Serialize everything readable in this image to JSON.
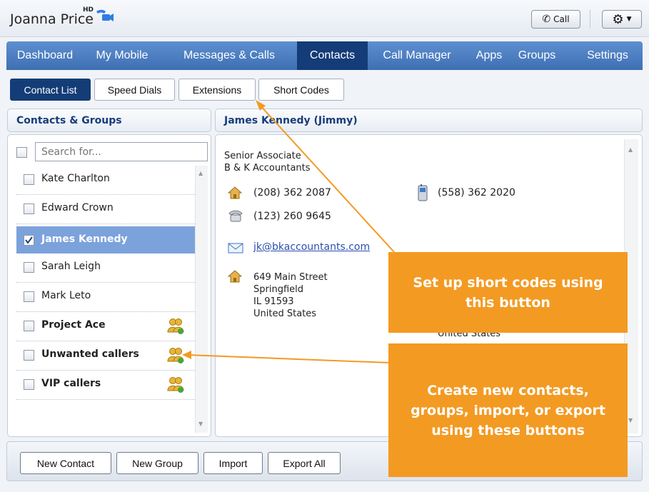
{
  "header": {
    "user_name": "Joanna Price",
    "hd_label": "HD",
    "call_label": "Call"
  },
  "nav": {
    "items": [
      {
        "label": "Dashboard"
      },
      {
        "label": "My Mobile"
      },
      {
        "label": "Messages & Calls"
      },
      {
        "label": "Contacts",
        "active": true
      },
      {
        "label": "Call Manager"
      },
      {
        "label": "Apps"
      },
      {
        "label": "Groups"
      },
      {
        "label": "Settings"
      }
    ]
  },
  "subtabs": [
    {
      "label": "Contact List",
      "active": true
    },
    {
      "label": "Speed Dials"
    },
    {
      "label": "Extensions"
    },
    {
      "label": "Short Codes"
    }
  ],
  "contacts_panel": {
    "title": "Contacts & Groups",
    "search_placeholder": "Search for...",
    "items": [
      {
        "label": "Kate Charlton",
        "type": "contact",
        "checked": false
      },
      {
        "label": "Edward Crown",
        "type": "contact",
        "checked": false
      },
      {
        "label": "James Kennedy",
        "type": "contact",
        "checked": true,
        "selected": true
      },
      {
        "label": "Sarah Leigh",
        "type": "contact",
        "checked": false
      },
      {
        "label": "Mark Leto",
        "type": "contact",
        "checked": false
      },
      {
        "label": "Project Ace",
        "type": "group",
        "checked": false
      },
      {
        "label": "Unwanted callers",
        "type": "group",
        "checked": false
      },
      {
        "label": "VIP callers",
        "type": "group",
        "checked": false
      }
    ]
  },
  "details_panel": {
    "title": "James Kennedy (Jimmy)",
    "job_title": "Senior Associate",
    "company": "B & K Accountants",
    "home_phone": "(208) 362 2087",
    "mobile_phone": "(558) 362 2020",
    "work_phone": "(123) 260 9645",
    "email": "jk@bkaccountants.com",
    "address": {
      "street": "649 Main Street",
      "city": "Springfield",
      "state_zip": "IL 91593",
      "country": "United States"
    },
    "address_partial": "United States"
  },
  "callouts": {
    "short_codes": "Set up short codes using this button",
    "buttons": "Create new contacts, groups, import, or export using these buttons"
  },
  "bottom_bar": {
    "new_contact": "New Contact",
    "new_group": "New Group",
    "import": "Import",
    "export_all": "Export All"
  },
  "colors": {
    "nav_bg": "#4a7cc0",
    "nav_active": "#133c78",
    "accent": "#173d7a",
    "callout": "#f39a22",
    "selected_row": "#7ca2dc"
  }
}
